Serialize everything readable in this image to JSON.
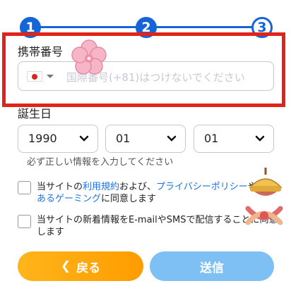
{
  "stepper": {
    "steps": [
      "1",
      "2",
      "3"
    ],
    "accent": "#1565d8"
  },
  "phone": {
    "label": "携帯番号",
    "country": "jp-flag-icon",
    "placeholder": "国際番号(+81)はつけないでください"
  },
  "birthday": {
    "label": "誕生日",
    "year": "1990",
    "month": "01",
    "day": "01",
    "hint": "必ず正しい情報を入力してください"
  },
  "consent1": {
    "t1": "当サイトの",
    "link1": "利用規約",
    "t2": "および、",
    "link2": "プライバシーポリシー",
    "t3": "や",
    "link3": "責任あるゲーミング",
    "t4": "に同意します"
  },
  "consent2": {
    "text": "当サイトの新着情報をE-mailやSMSで配信することに同意します"
  },
  "buttons": {
    "back": "戻る",
    "send": "送信"
  },
  "colors": {
    "highlight": "#e2231a",
    "back": "#ffa30a",
    "send": "#7ec0f4"
  }
}
